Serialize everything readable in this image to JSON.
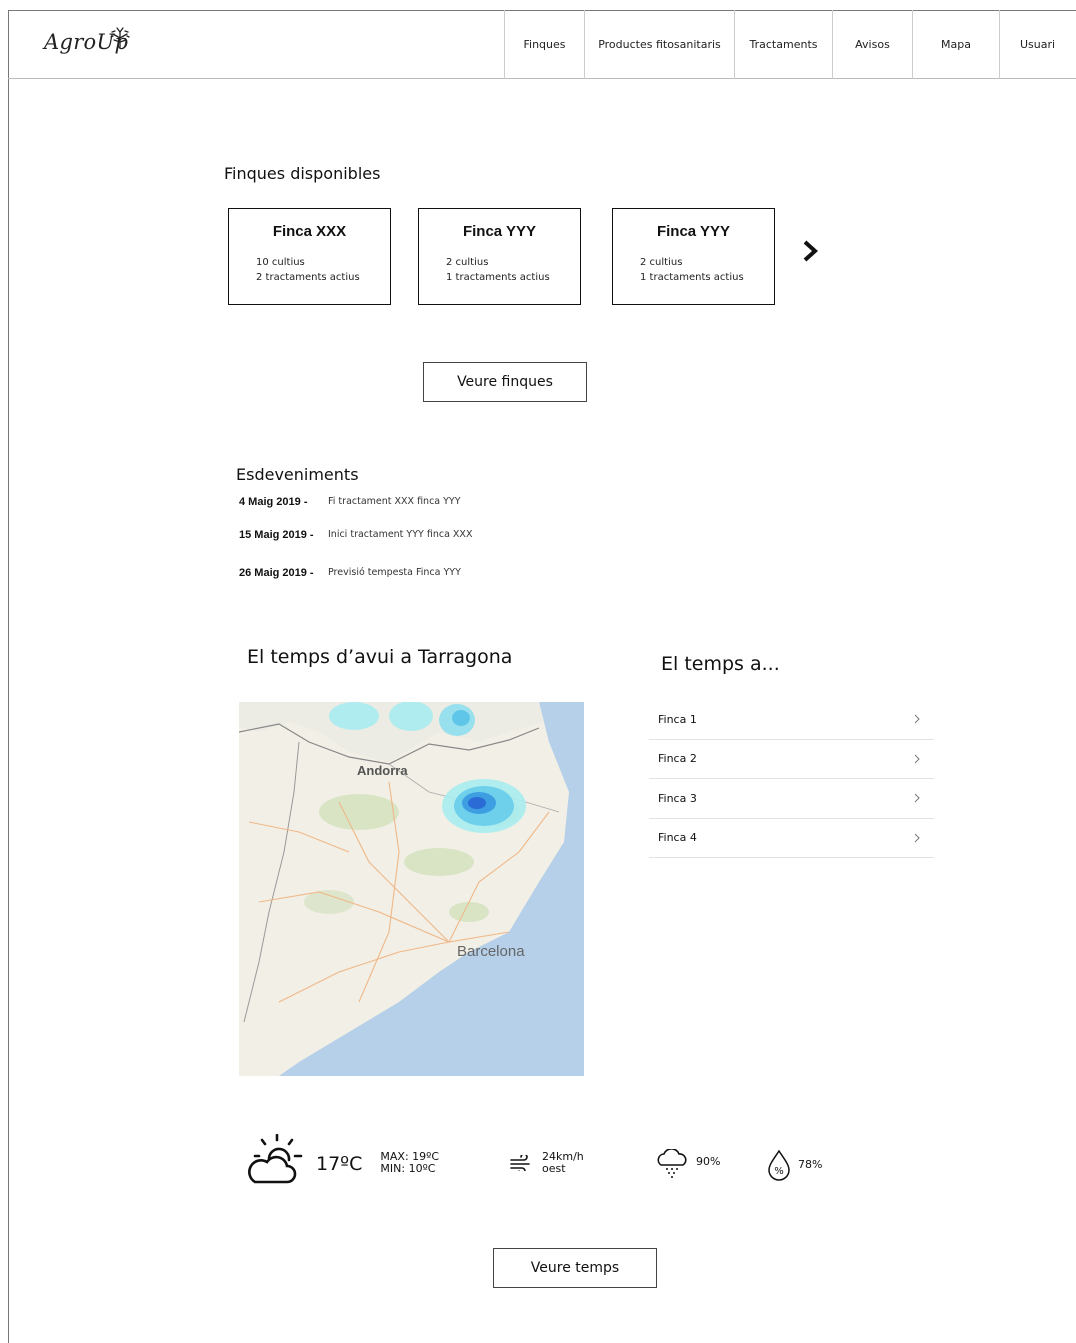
{
  "header": {
    "logo_text": "AgroUp",
    "nav": [
      {
        "label": "Finques",
        "width": 80
      },
      {
        "label": "Productes fitosanitaris",
        "width": 150
      },
      {
        "label": "Tractaments",
        "width": 98
      },
      {
        "label": "Avisos",
        "width": 80
      },
      {
        "label": "Mapa",
        "width": 87
      },
      {
        "label": "Usuari",
        "width": 90
      }
    ]
  },
  "farms_section": {
    "title": "Finques disponibles",
    "cards": [
      {
        "name": "Finca XXX",
        "crops": "10 cultius",
        "treatments": "2 tractaments actius"
      },
      {
        "name": "Finca YYY",
        "crops": "2 cultius",
        "treatments": "1 tractaments actius"
      },
      {
        "name": "Finca YYY",
        "crops": "2 cultius",
        "treatments": "1 tractaments actius"
      }
    ],
    "button_label": "Veure finques"
  },
  "events_section": {
    "title": "Esdeveniments",
    "items": [
      {
        "date": "4 Maig 2019 -",
        "text": "Fi tractament XXX finca YYY"
      },
      {
        "date": "15 Maig 2019 -",
        "text": "Inici tractament YYY finca XXX"
      },
      {
        "date": "26 Maig 2019 -",
        "text": "Previsió tempesta Finca YYY"
      }
    ]
  },
  "weather_section": {
    "title": "El temps d’avui a Tarragona",
    "map_labels": {
      "andorra": "Andorra",
      "barcelona": "Barcelona"
    },
    "temperature": "17ºC",
    "max": "MAX: 19ºC",
    "min": "MIN: 10ºC",
    "wind_speed": "24km/h",
    "wind_dir": "oest",
    "rain": "90%",
    "humidity": "78%",
    "button_label": "Veure temps"
  },
  "farm_weather": {
    "title": "El temps a...",
    "items": [
      "Finca 1",
      "Finca 2",
      "Finca 3",
      "Finca 4"
    ]
  }
}
